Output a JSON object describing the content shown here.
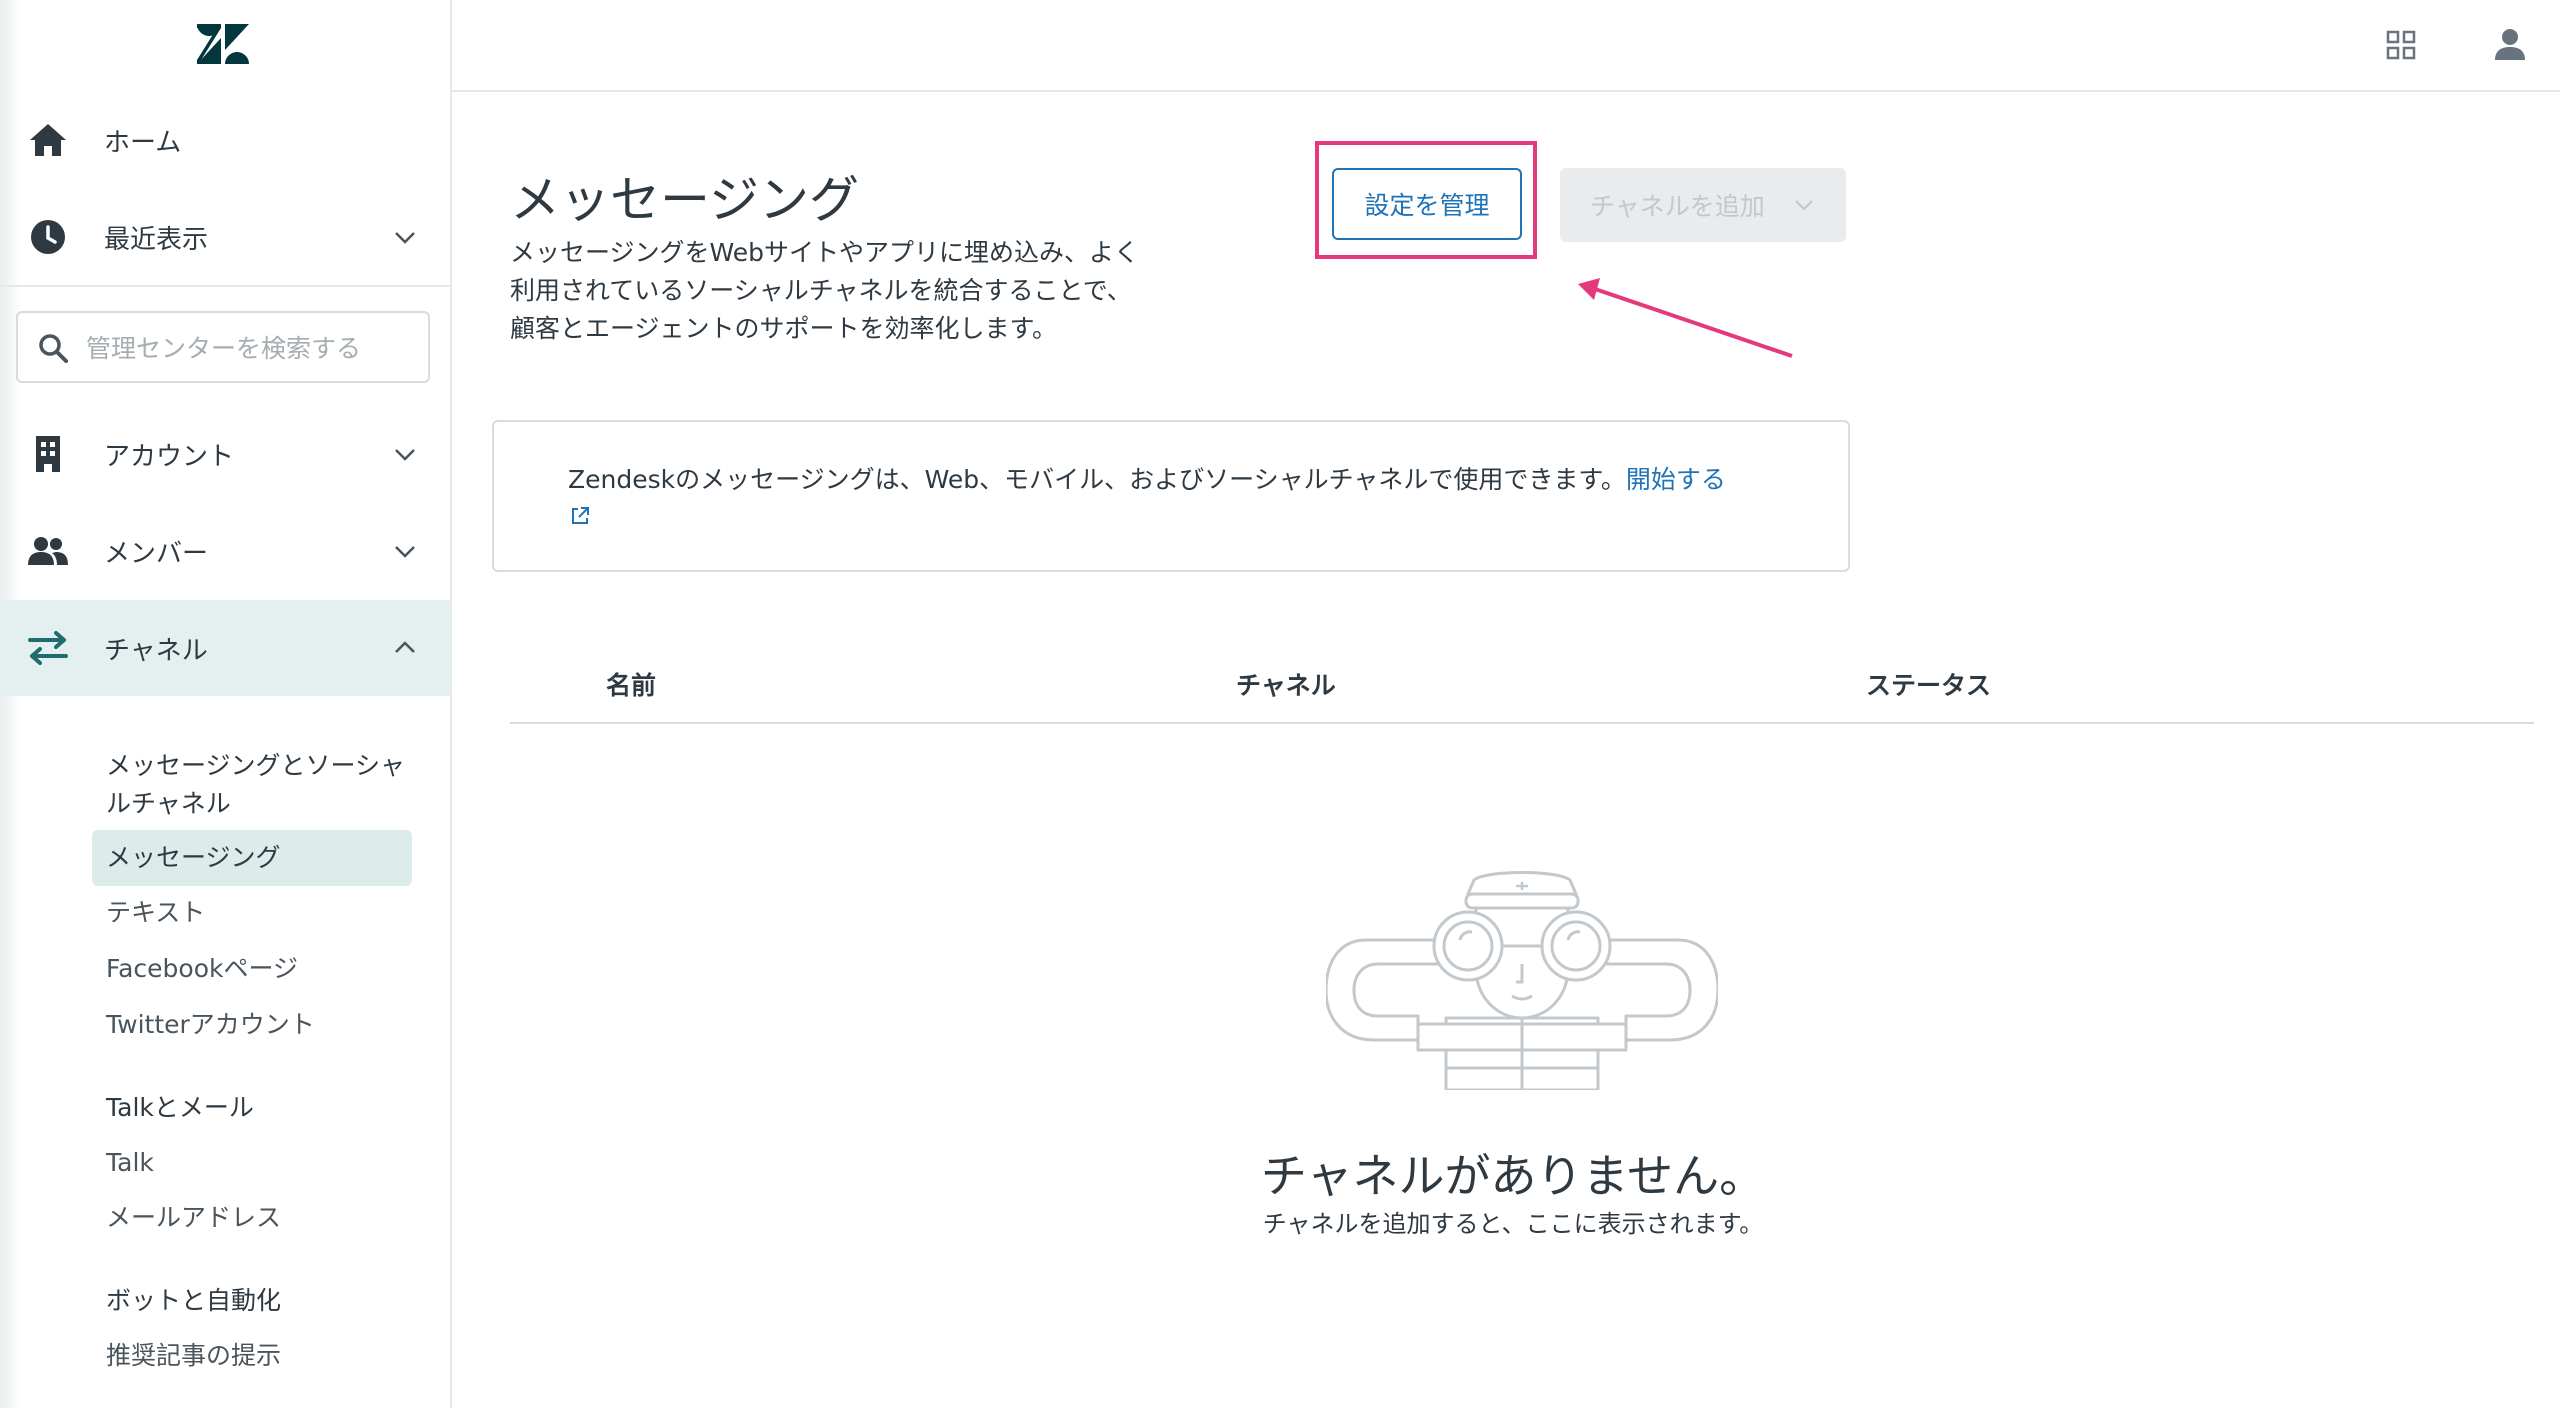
{
  "sidebar": {
    "nav": {
      "home": "ホーム",
      "recent": "最近表示",
      "account": "アカウント",
      "members": "メンバー",
      "channels": "チャネル"
    },
    "search_placeholder": "管理センターを検索する",
    "sub": {
      "messaging_social": "メッセージングとソーシャルチャネル",
      "messaging": "メッセージング",
      "text": "テキスト",
      "facebook": "Facebookページ",
      "twitter": "Twitterアカウント",
      "talk_email_head": "Talkとメール",
      "talk": "Talk",
      "email": "メールアドレス",
      "bots_head": "ボットと自動化",
      "suggested": "推奨記事の提示"
    }
  },
  "main": {
    "title": "メッセージング",
    "description": "メッセージングをWebサイトやアプリに埋め込み、よく利用されているソーシャルチャネルを統合することで、顧客とエージェントのサポートを効率化します。",
    "manage_button": "設定を管理",
    "add_channel_button": "チャネルを追加",
    "info_text": "Zendeskのメッセージングは、Web、モバイル、およびソーシャルチャネルで使用できます。",
    "info_link": "開始する",
    "table_headers": [
      "名前",
      "チャネル",
      "ステータス"
    ],
    "empty_title": "チャネルがありません。",
    "empty_subtitle": "チャネルを追加すると、ここに表示されます。"
  },
  "colors": {
    "accent": "#1f73b7",
    "highlight": "#e5387d",
    "active_bg": "#e4efef"
  },
  "icons": [
    "zendesk-logo",
    "home-icon",
    "clock-icon",
    "chevron-down-icon",
    "search-icon",
    "building-icon",
    "people-icon",
    "arrows-icon",
    "chevron-up-icon",
    "apps-grid-icon",
    "user-icon",
    "external-link-icon"
  ]
}
